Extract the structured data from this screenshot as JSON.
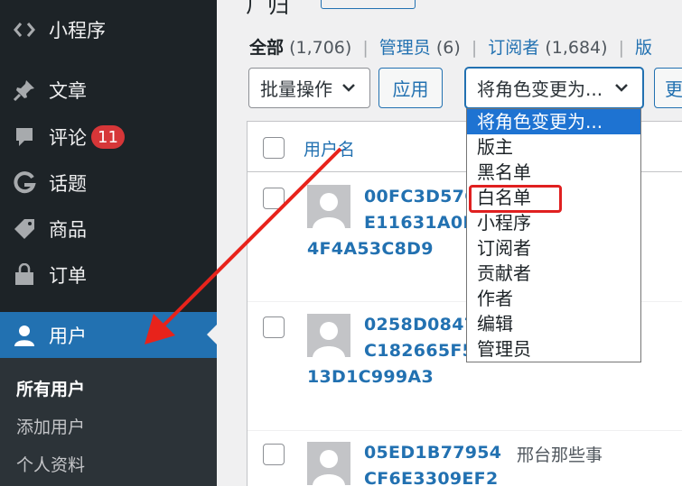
{
  "sidebar": {
    "items": [
      {
        "label": "小程序",
        "icon": "code-icon"
      },
      {
        "label": "文章",
        "icon": "pin-icon"
      },
      {
        "label": "评论",
        "icon": "comment-icon",
        "badge": "11"
      },
      {
        "label": "话题",
        "icon": "g-icon"
      },
      {
        "label": "商品",
        "icon": "tag-icon"
      },
      {
        "label": "订单",
        "icon": "bag-icon"
      },
      {
        "label": "用户",
        "icon": "user-icon"
      }
    ],
    "submenu": [
      "所有用户",
      "添加用户",
      "个人资料"
    ]
  },
  "filters": {
    "all": "全部",
    "all_count": "(1,706)",
    "admin": "管理员",
    "admin_count": "(6)",
    "subscriber": "订阅者",
    "subscriber_count": "(1,684)",
    "next_partial": "版"
  },
  "toolbar": {
    "bulk_label": "批量操作",
    "apply_label": "应用",
    "role_select_label": "将角色变更为...",
    "change_partial": "更"
  },
  "table": {
    "col_username": "用户名",
    "rows": [
      {
        "line1": "00FC3D57C",
        "line2": "E11631A0B",
        "line3": "4F4A53C8D9",
        "name": ""
      },
      {
        "line1": "0258D0847",
        "line2": "C182665F5",
        "line3": "13D1C999A3",
        "name": ""
      },
      {
        "line1": "05ED1B77954",
        "line2": "CF6E3309EF2",
        "line3": "",
        "name": "邢台那些事"
      }
    ]
  },
  "role_options": [
    "将角色变更为...",
    "版主",
    "黑名单",
    "白名单",
    "小程序",
    "订阅者",
    "贡献者",
    "作者",
    "编辑",
    "管理员"
  ],
  "colors": {
    "sidebar_bg": "#1d2327",
    "accent": "#2271b1",
    "highlight": "#e02020",
    "selected_option": "#1e73d2"
  }
}
